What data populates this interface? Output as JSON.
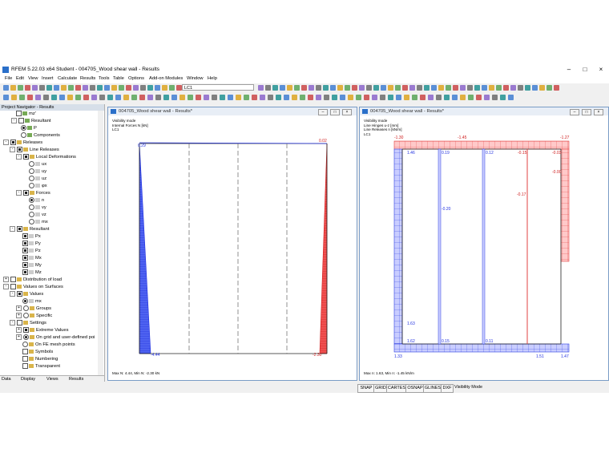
{
  "window": {
    "title": "RFEM 5.22.03 x64 Student - 004705_Wood shear wall - Results"
  },
  "menu": [
    "File",
    "Edit",
    "View",
    "Insert",
    "Calculate",
    "Results",
    "Tools",
    "Table",
    "Options",
    "Add-on Modules",
    "Window",
    "Help"
  ],
  "toolbar": {
    "load_case": "LC1"
  },
  "navigator": {
    "title": "Project Navigator - Results",
    "tabs": [
      "Data",
      "Display",
      "Views",
      "Results"
    ],
    "items": [
      "mz'",
      "Resultant",
      "P",
      "Components",
      "Releases",
      "Line Releases",
      "Local Deformations",
      "ux",
      "uy",
      "uz",
      "φx",
      "Forces",
      "n",
      "vy",
      "vz",
      "mx",
      "Resultant",
      "Px",
      "Py",
      "Pz",
      "Mx",
      "My",
      "Mz",
      "Distribution of load",
      "Values on Surfaces",
      "Values",
      "mx",
      "Groups",
      "Specific",
      "Settings",
      "Extreme Values",
      "On grid and user-defined poi",
      "On FE mesh points",
      "Symbols",
      "Numbering",
      "Transparent"
    ]
  },
  "left_window": {
    "title": "004705_Wood shear wall - Results*",
    "info": [
      "Visibility mode",
      "Internal Forces N [kN]",
      "LC1"
    ],
    "values": {
      "top_left": "0.29",
      "top_right": "0.02",
      "bottom_left": "-4.44",
      "bottom_right": "-2.30"
    },
    "footer": "Max N: 4.44, Min N: -2.30 kN"
  },
  "right_window": {
    "title": "004705_Wood shear wall - Results*",
    "info": [
      "Visibility mode",
      "Line Hinges u-z [mm]",
      "Line Releases n [kN/m]",
      "LC1"
    ],
    "top_values": [
      "-1.30",
      "-1.45",
      "-1.27"
    ],
    "inner_values": [
      "1.46",
      "0.19",
      "0.12",
      "-0.15",
      "-0.03",
      "-0.00",
      "-0.20",
      "-0.17",
      "1.63",
      "1.62",
      "0.15",
      "0.11"
    ],
    "bottom_values": [
      "1.33",
      "1.51",
      "1.47"
    ],
    "footer": "Max n: 1.63, Min n: -1.45 kN/m"
  },
  "statusbar": [
    "SNAP",
    "GRID",
    "CARTES",
    "OSNAP",
    "GLINES",
    "DXF"
  ],
  "status_text": "Visibility Mode",
  "colors": {
    "positive": "#e23030",
    "negative": "#2030e0"
  }
}
